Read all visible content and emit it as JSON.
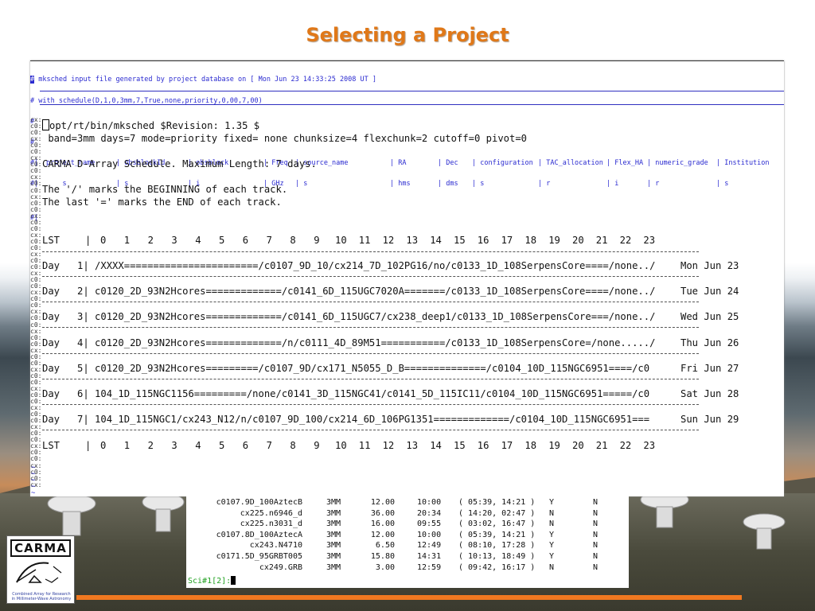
{
  "slide_title": "Selecting a Project",
  "header": {
    "line1": "mksched input file generated by project database on [ Mon Jun 23 14:33:25 2008 UT ]",
    "line2": "# with schedule(D,1,0,3mm,7,True,none,priority,0,00,7,00)",
    "hash": "#",
    "columns": [
      {
        "name": "project_name",
        "type": "s"
      },
      {
        "name": "obsblockId",
        "type": "s"
      },
      {
        "name": "obsblock",
        "type": "i"
      },
      {
        "name": "Freq",
        "type": "GHz"
      },
      {
        "name": "source_name",
        "type": "s"
      },
      {
        "name": "RA",
        "type": "hms"
      },
      {
        "name": "Dec",
        "type": "dms"
      },
      {
        "name": "configuration",
        "type": "s"
      },
      {
        "name": "TAC_allocation",
        "type": "r"
      },
      {
        "name": "Flex_HA",
        "type": "i"
      },
      {
        "name": "numeric_grade",
        "type": "r"
      },
      {
        "name": "Institution",
        "type": "s"
      }
    ]
  },
  "terminal": {
    "revision_line": "opt/rt/bin/mksched $Revision: 1.35 $",
    "params_line": " band=3mm days=7 mode=priority fixed= none chunksize=4 flexchunk=2 cutoff=0 pivot=0",
    "schedule_title": "CARMA D-Array Schedule. Maximum Length: 7 days.",
    "note1": "The '/' marks the BEGINNING of each track.",
    "note2": "The last '=' marks the END of each track.",
    "lst_label": "LST",
    "hours": [
      "0",
      "1",
      "2",
      "3",
      "4",
      "5",
      "6",
      "7",
      "8",
      "9",
      "10",
      "11",
      "12",
      "13",
      "14",
      "15",
      "16",
      "17",
      "18",
      "19",
      "20",
      "21",
      "22",
      "23"
    ],
    "days": [
      {
        "label": "Day   1|",
        "track": "/XXXX=======================/c0107_9D_10/cx214_7D_102PG16/no/c0133_1D_108SerpensCore====/none../",
        "date": "Mon Jun 23"
      },
      {
        "label": "Day   2|",
        "track": "c0120_2D_93N2Hcores=============/c0141_6D_115UGC7020A=======/c0133_1D_108SerpensCore====/none../",
        "date": "Tue Jun 24"
      },
      {
        "label": "Day   3|",
        "track": "c0120_2D_93N2Hcores=============/c0141_6D_115UGC7/cx238_deep1/c0133_1D_108SerpensCore===/none../",
        "date": "Wed Jun 25"
      },
      {
        "label": "Day   4|",
        "track": "c0120_2D_93N2Hcores=============/n/c0111_4D_89M51===========/c0133_1D_108SerpensCore=/none...../",
        "date": "Thu Jun 26"
      },
      {
        "label": "Day   5|",
        "track": "c0120_2D_93N2Hcores=========/c0107_9D/cx171_N5055_D_B==============/c0104_10D_115NGC6951====/c0",
        "date": "Fri Jun 27"
      },
      {
        "label": "Day   6|",
        "track": "104_1D_115NGC1156=========/none/c0141_3D_115NGC41/c0141_5D_115IC11/c0104_10D_115NGC6951=====/c0",
        "date": "Sat Jun 28"
      },
      {
        "label": "Day   7|",
        "track": "104_1D_115NGC1/cx243_N12/n/c0107_9D_100/cx214_6D_106PG1351=============/c0104_10D_115NGC6951===",
        "date": "Sun Jun 29"
      }
    ],
    "gutter_c0": "c0:",
    "gutter_cx": "cx:",
    "tilde": "~"
  },
  "lower_terminal": {
    "rows": [
      [
        "c0107.9D_100AztecB",
        "3MM",
        "12.00",
        "10:00",
        "( 05:39, 14:21 )",
        "Y",
        "N"
      ],
      [
        "cx225.n6946_d",
        "3MM",
        "36.00",
        "20:34",
        "( 14:20, 02:47 )",
        "N",
        "N"
      ],
      [
        "cx225.n3031_d",
        "3MM",
        "16.00",
        "09:55",
        "( 03:02, 16:47 )",
        "N",
        "N"
      ],
      [
        "c0107.8D_100AztecA",
        "3MM",
        "12.00",
        "10:00",
        "( 05:39, 14:21 )",
        "Y",
        "N"
      ],
      [
        "cx243.N4710",
        "3MM",
        "6.50",
        "12:49",
        "( 08:10, 17:28 )",
        "Y",
        "N"
      ],
      [
        "c0171.5D_95GRBT005",
        "3MM",
        "15.80",
        "14:31",
        "( 10:13, 18:49 )",
        "Y",
        "N"
      ],
      [
        "cx249.GRB",
        "3MM",
        "3.00",
        "12:59",
        "( 09:42, 16:17 )",
        "N",
        "N"
      ]
    ],
    "prompt": "Sci#1[2]:"
  },
  "logo": {
    "word": "CARMA",
    "tagline_1": "Combined Array for Research",
    "tagline_2": "in Millimeter-Wave Astronomy"
  },
  "colors": {
    "title": "#e07818",
    "accent_line": "#f07820",
    "header_text": "#2a2ad0",
    "prompt": "#20a020"
  }
}
